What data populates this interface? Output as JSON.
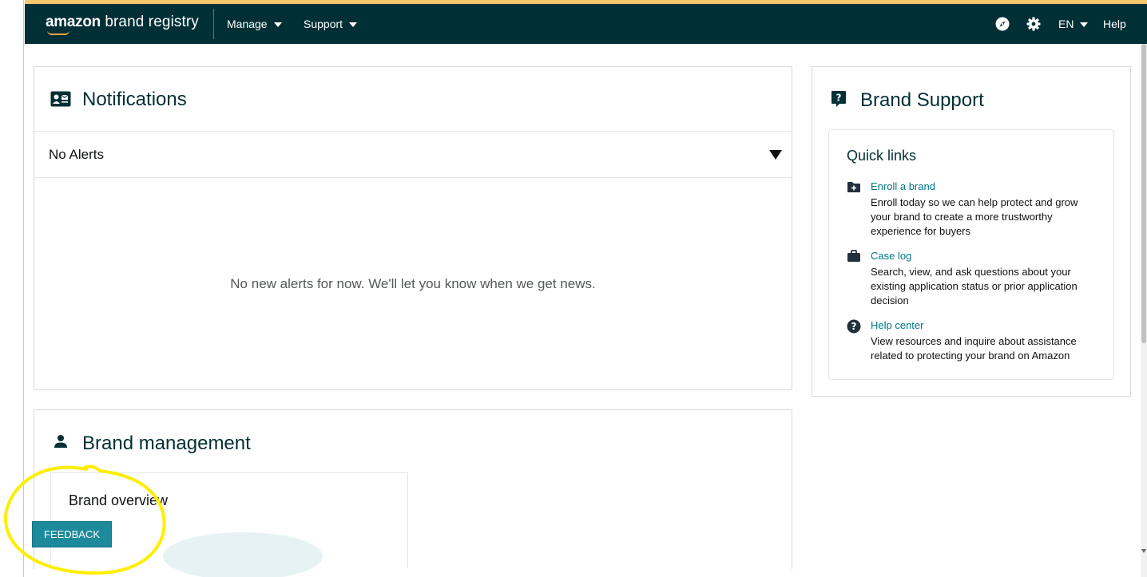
{
  "header": {
    "logo_brand": "amazon",
    "logo_product": " brand registry",
    "nav": [
      {
        "label": "Manage"
      },
      {
        "label": "Support"
      }
    ],
    "language": "EN",
    "help": "Help",
    "icons": [
      "compass-icon",
      "gear-icon"
    ]
  },
  "notifications": {
    "title": "Notifications",
    "alerts_label": "No Alerts",
    "empty_message": "No new alerts for now. We'll let you know when we get news."
  },
  "brand_support": {
    "title": "Brand Support",
    "quick_links_title": "Quick links",
    "links": [
      {
        "label": "Enroll a brand",
        "description": "Enroll today so we can help protect and grow your brand to create a more trustworthy experience for buyers",
        "icon": "folder-plus-icon"
      },
      {
        "label": "Case log",
        "description": "Search, view, and ask questions about your existing application status or prior application decision",
        "icon": "briefcase-icon"
      },
      {
        "label": "Help center",
        "description": "View resources and inquire about assistance related to protecting your brand on Amazon",
        "icon": "question-circle-icon"
      }
    ]
  },
  "brand_management": {
    "title": "Brand management",
    "overview_title": "Brand overview"
  },
  "feedback": {
    "label": "FEEDBACK"
  },
  "colors": {
    "header_bg": "#002f36",
    "header_accent": "#f7c86b",
    "link": "#00778b",
    "feedback_bg": "#1c8a9a",
    "annotation": "#ffee00"
  }
}
